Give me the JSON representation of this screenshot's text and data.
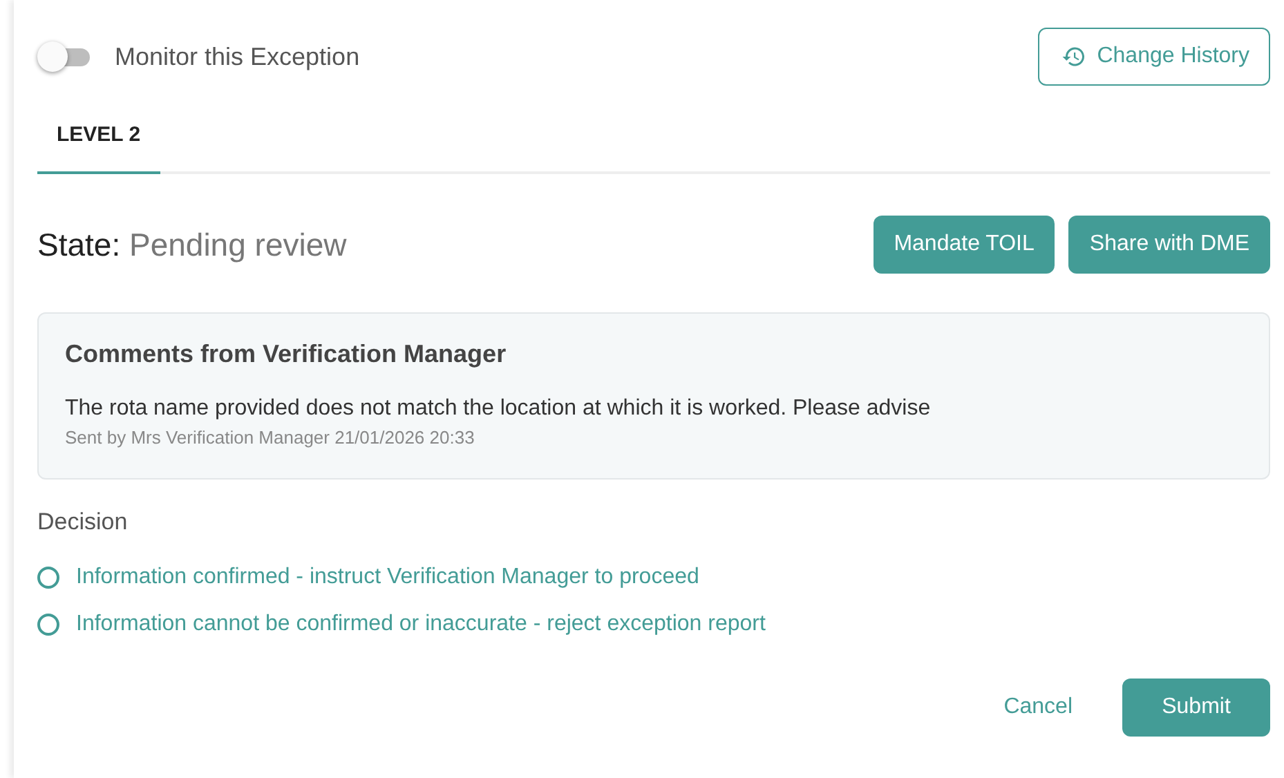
{
  "monitor_toggle": {
    "label": "Monitor this Exception",
    "on": false
  },
  "change_history_button": {
    "label": "Change History"
  },
  "tabs": [
    {
      "label": "LEVEL 2",
      "selected": true
    }
  ],
  "state": {
    "label": "State:",
    "value": "Pending review"
  },
  "action_buttons": [
    "Mandate TOIL",
    "Share with DME"
  ],
  "comments": {
    "title": "Comments from Verification Manager",
    "message": "The rota name provided does not match the location at which it is worked. Please advise",
    "meta": "Sent by Mrs Verification Manager 21/01/2026 20:33"
  },
  "decision": {
    "label": "Decision",
    "options": [
      {
        "label": "Information confirmed - instruct Verification Manager to proceed",
        "selected": false
      },
      {
        "label": "Information cannot be confirmed or inaccurate - reject exception report",
        "selected": false
      }
    ]
  },
  "footer": {
    "cancel": "Cancel",
    "submit": "Submit"
  }
}
